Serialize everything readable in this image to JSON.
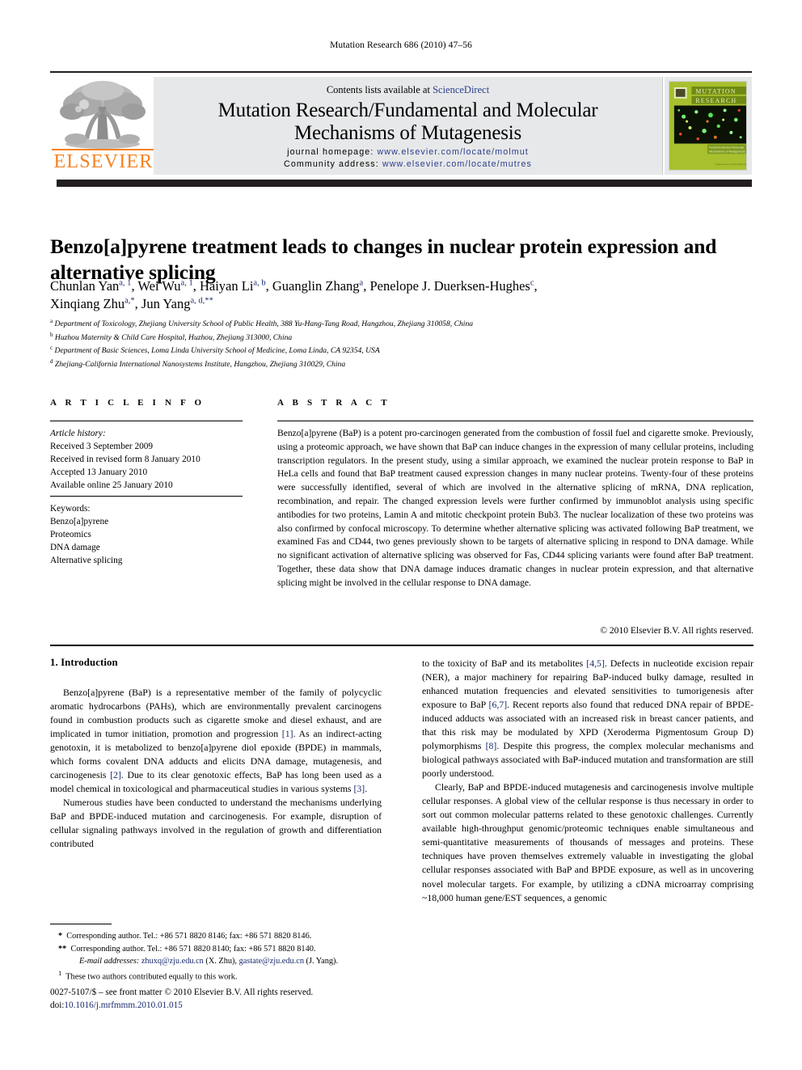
{
  "running_head": "Mutation Research 686 (2010) 47–56",
  "masthead": {
    "contents_prefix": "Contents lists available at ",
    "contents_link": "ScienceDirect",
    "journal_title_line1": "Mutation Research/Fundamental and Molecular",
    "journal_title_line2": "Mechanisms of Mutagenesis",
    "homepage_label": "journal homepage:",
    "homepage_url": "www.elsevier.com/locate/molmut",
    "community_label": "Community address:",
    "community_url": "www.elsevier.com/locate/mutres",
    "publisher": "ELSEVIER",
    "cover_title_line1": "MUTATION",
    "cover_title_line2": "RESEARCH",
    "cover_subtitle_line1": "Fundamental and Molecular",
    "cover_subtitle_line2": "Mechanisms of Mutagenesis"
  },
  "article": {
    "title": "Benzo[a]pyrene treatment leads to changes in nuclear protein expression and alternative splicing",
    "authors_line1_html": "Chunlan Yan<sup>a, 1</sup>, Wei Wu<sup>a, 1</sup>, Haiyan Li<sup>a, b</sup>, Guanglin Zhang<sup>a</sup>, Penelope J. Duerksen-Hughes<sup>c</sup>,",
    "authors_line2_html": "Xinqiang Zhu<sup>a,*</sup>, Jun Yang<sup>a, d,**</sup>",
    "affiliations": [
      {
        "marker": "a",
        "text": "Department of Toxicology, Zhejiang University School of Public Health, 388 Yu-Hang-Tang Road, Hangzhou, Zhejiang 310058, China"
      },
      {
        "marker": "b",
        "text": "Huzhou Maternity & Child Care Hospital, Huzhou, Zhejiang 313000, China"
      },
      {
        "marker": "c",
        "text": "Department of Basic Sciences, Loma Linda University School of Medicine, Loma Linda, CA 92354, USA"
      },
      {
        "marker": "d",
        "text": "Zhejiang-California International Nanosystems Institute, Hangzhou, Zhejiang 310029, China"
      }
    ]
  },
  "article_info": {
    "heading": "A R T I C L E   I N F O",
    "history_label": "Article history:",
    "history": [
      "Received 3 September 2009",
      "Received in revised form 8 January 2010",
      "Accepted 13 January 2010",
      "Available online 25 January 2010"
    ],
    "keywords_label": "Keywords:",
    "keywords": [
      "Benzo[a]pyrene",
      "Proteomics",
      "DNA damage",
      "Alternative splicing"
    ]
  },
  "abstract": {
    "heading": "A B S T R A C T",
    "text": "Benzo[a]pyrene (BaP) is a potent pro-carcinogen generated from the combustion of fossil fuel and cigarette smoke. Previously, using a proteomic approach, we have shown that BaP can induce changes in the expression of many cellular proteins, including transcription regulators. In the present study, using a similar approach, we examined the nuclear protein response to BaP in HeLa cells and found that BaP treatment caused expression changes in many nuclear proteins. Twenty-four of these proteins were successfully identified, several of which are involved in the alternative splicing of mRNA, DNA replication, recombination, and repair. The changed expression levels were further confirmed by immunoblot analysis using specific antibodies for two proteins, Lamin A and mitotic checkpoint protein Bub3. The nuclear localization of these two proteins was also confirmed by confocal microscopy. To determine whether alternative splicing was activated following BaP treatment, we examined Fas and CD44, two genes previously shown to be targets of alternative splicing in respond to DNA damage. While no significant activation of alternative splicing was observed for Fas, CD44 splicing variants were found after BaP treatment. Together, these data show that DNA damage induces dramatic changes in nuclear protein expression, and that alternative splicing might be involved in the cellular response to DNA damage.",
    "copyright": "© 2010 Elsevier B.V. All rights reserved."
  },
  "body": {
    "section_heading": "1.  Introduction",
    "left_paragraphs_html": [
      "Benzo[a]pyrene (BaP) is a representative member of the family of polycyclic aromatic hydrocarbons (PAHs), which are environmentally prevalent carcinogens found in combustion products such as cigarette smoke and diesel exhaust, and are implicated in tumor initiation, promotion and progression <span class=\"ref\">[1]</span>. As an indirect-acting genotoxin, it is metabolized to benzo[a]pyrene diol epoxide (BPDE) in mammals, which forms covalent DNA adducts and elicits DNA damage, mutagenesis, and carcinogenesis <span class=\"ref\">[2]</span>. Due to its clear genotoxic effects, BaP has long been used as a model chemical in toxicological and pharmaceutical studies in various systems <span class=\"ref\">[3]</span>.",
      "Numerous studies have been conducted to understand the mechanisms underlying BaP and BPDE-induced mutation and carcinogenesis. For example, disruption of cellular signaling pathways involved in the regulation of growth and differentiation contributed"
    ],
    "right_paragraphs_html": [
      "to the toxicity of BaP and its metabolites <span class=\"ref\">[4,5]</span>. Defects in nucleotide excision repair (NER), a major machinery for repairing BaP-induced bulky damage, resulted in enhanced mutation frequencies and elevated sensitivities to tumorigenesis after exposure to BaP <span class=\"ref\">[6,7]</span>. Recent reports also found that reduced DNA repair of BPDE-induced adducts was associated with an increased risk in breast cancer patients, and that this risk may be modulated by XPD (Xeroderma Pigmentosum Group D) polymorphisms <span class=\"ref\">[8]</span>. Despite this progress, the complex molecular mechanisms and biological pathways associated with BaP-induced mutation and transformation are still poorly understood.",
      "Clearly, BaP and BPDE-induced mutagenesis and carcinogenesis involve multiple cellular responses. A global view of the cellular response is thus necessary in order to sort out common molecular patterns related to these genotoxic challenges. Currently available high-throughput genomic/proteomic techniques enable simultaneous and semi-quantitative measurements of thousands of messages and proteins. These techniques have proven themselves extremely valuable in investigating the global cellular responses associated with BaP and BPDE exposure, as well as in uncovering novel molecular targets. For example, by utilizing a cDNA microarray comprising ~18,000 human gene/EST sequences, a genomic"
    ]
  },
  "footnotes": {
    "corr1_html": "<b>*</b>&nbsp; Corresponding author. Tel.: +86 571 8820 8146; fax: +86 571 8820 8146.",
    "corr2_html": "<b>**</b>&nbsp; Corresponding author. Tel.: +86 571 8820 8140; fax: +86 571 8820 8140.",
    "emails_html": "<span class=\"it\">E-mail addresses:</span> <span class=\"mail\">zhuxq@zju.edu.cn</span> (X. Zhu), <span class=\"mail\">gastate@zju.edu.cn</span> (J. Yang).",
    "equal_contrib_html": "<sup>1</sup>&nbsp; These two authors contributed equally to this work."
  },
  "imprint": {
    "issn_line": "0027-5107/$ – see front matter © 2010 Elsevier B.V. All rights reserved.",
    "doi_label": "doi:",
    "doi_value": "10.1016/j.mrfmmm.2010.01.015"
  },
  "colors": {
    "elsevier_orange": "#F58220",
    "link_blue": "#2b3e8c",
    "ref_blue": "#1a2a6c",
    "band_gray": "#e7e8e9",
    "dark_bar": "#231f20",
    "cover_green": "#a8bf2e"
  }
}
